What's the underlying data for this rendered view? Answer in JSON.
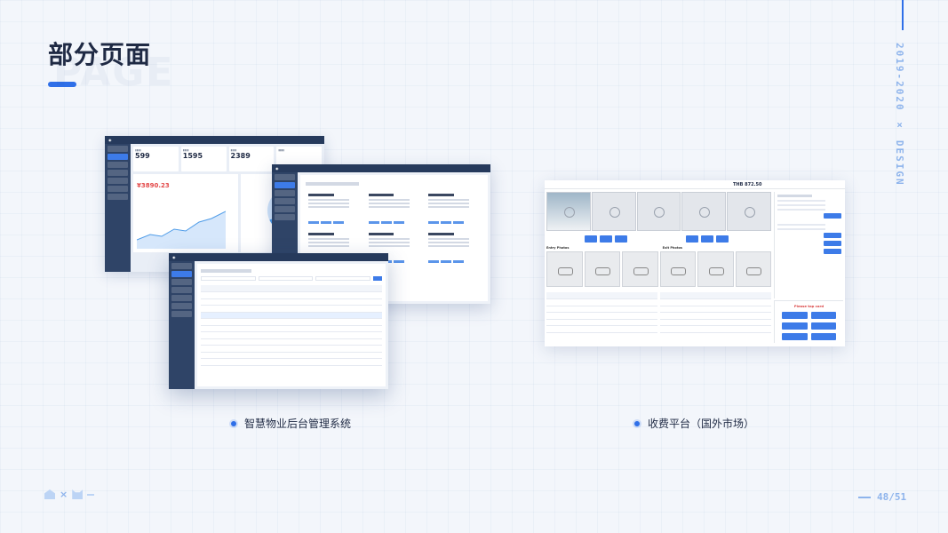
{
  "title": "部分页面",
  "watermark": "PAGE",
  "vertical_label": "2019-2020 × DESIGN",
  "left_group": {
    "caption": "智慧物业后台管理系统",
    "dashboard": {
      "kpis": [
        "599",
        "1595",
        "2389"
      ],
      "money": "¥3890.23"
    }
  },
  "right_group": {
    "caption": "收费平台（国外市场）",
    "header_amount": "THB 872.50",
    "section_entry": "Entry Photos",
    "section_exit": "Exit Photos",
    "pay_title": "Please tap card"
  },
  "footer": {
    "cross": "×",
    "page": "48/51"
  },
  "colors": {
    "accent": "#2f6fe8",
    "light_accent": "#8eb4ec",
    "dark_nav": "#263a5c"
  }
}
